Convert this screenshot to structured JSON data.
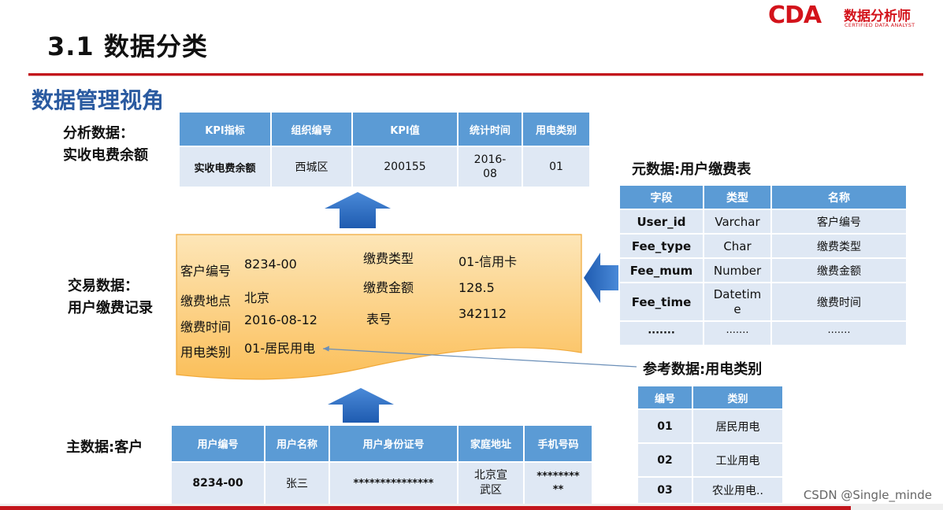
{
  "slide": {
    "title": "3.1 数据分类",
    "subtitle": "数据管理视角",
    "logo_text": "CDA",
    "logo_cn": "数据分析师",
    "logo_en": "CERTIFIED DATA ANALYST",
    "watermark": "CSDN @Single_minde"
  },
  "labels": {
    "analysis_1": "分析数据：",
    "analysis_2": "实收电费余额",
    "transaction_1": "交易数据：",
    "transaction_2": "用户缴费记录",
    "master": "主数据:客户",
    "metadata": "元数据:用户缴费表",
    "reference": "参考数据:用电类别"
  },
  "kpi_table": {
    "headers": [
      "KPI指标",
      "组织编号",
      "KPI值",
      "统计时间",
      "用电类别"
    ],
    "row": [
      "实收电费余额",
      "西城区",
      "200155",
      "2016-\n08",
      "01"
    ]
  },
  "transaction": {
    "left": [
      {
        "k": "客户编号",
        "v": "8234-00"
      },
      {
        "k": "缴费地点",
        "v": "北京"
      },
      {
        "k": "缴费时间",
        "v": "2016-08-12"
      },
      {
        "k": "用电类别",
        "v": "01-居民用电"
      }
    ],
    "right": [
      {
        "k": "缴费类型",
        "v": "01-信用卡"
      },
      {
        "k": "缴费金额",
        "v": "128.5"
      },
      {
        "k": "表号",
        "v": "342112"
      }
    ]
  },
  "meta_table": {
    "headers": [
      "字段",
      "类型",
      "名称"
    ],
    "rows": [
      [
        "User_id",
        "Varchar",
        "客户编号"
      ],
      [
        "Fee_type",
        "Char",
        "缴费类型"
      ],
      [
        "Fee_mum",
        "Number",
        "缴费金额"
      ],
      [
        "Fee_time",
        "Datetim\ne",
        "缴费时间"
      ],
      [
        "·······",
        "·······",
        "·······"
      ]
    ]
  },
  "ref_table": {
    "headers": [
      "编号",
      "类别"
    ],
    "rows": [
      [
        "01",
        "居民用电"
      ],
      [
        "02",
        "工业用电"
      ],
      [
        "03",
        "农业用电.."
      ]
    ]
  },
  "customer_table": {
    "headers": [
      "用户编号",
      "用户名称",
      "用户身份证号",
      "家庭地址",
      "手机号码"
    ],
    "row": [
      "8234-00",
      "张三",
      "***************",
      "北京宣\n武区",
      "********\n**"
    ]
  },
  "colors": {
    "accent_red": "#c3161c",
    "table_header": "#5b9bd5",
    "table_cell": "#dfe8f4",
    "card_fill": "#fcc96a",
    "arrow_blue": "#2f6fc4",
    "subtitle_blue": "#2a5aa0"
  },
  "icons": [
    "up-arrow-icon",
    "left-arrow-icon"
  ]
}
